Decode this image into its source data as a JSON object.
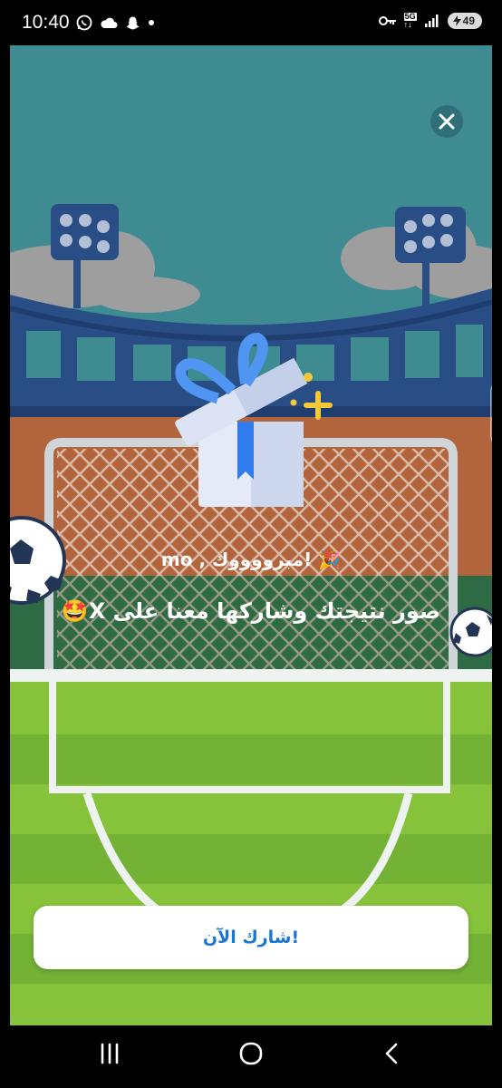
{
  "status_bar": {
    "time": "10:40",
    "battery_level": "49",
    "network": "5G",
    "network_sub": "↑↓",
    "icons_left": [
      "whatsapp-icon",
      "cloud-icon",
      "snapchat-icon",
      "dot-icon"
    ],
    "icons_right": [
      "key-icon",
      "network-5g-icon",
      "signal-icon",
      "battery-icon"
    ]
  },
  "game": {
    "congrats_text": "mo , مبرووووك! 🎉",
    "share_prompt": "صور نتيجتك وشاركها معنا على X🤩",
    "share_button": "شارك الآن!"
  },
  "colors": {
    "sky": "#3e8b92",
    "stands": "#294e86",
    "wall": "#b2643d",
    "grass_light": "#86c23a",
    "grass_dark": "#74b236",
    "button_text": "#1976d2"
  },
  "nav_bar": {
    "items": [
      "recent-apps-icon",
      "home-icon",
      "back-icon"
    ]
  }
}
